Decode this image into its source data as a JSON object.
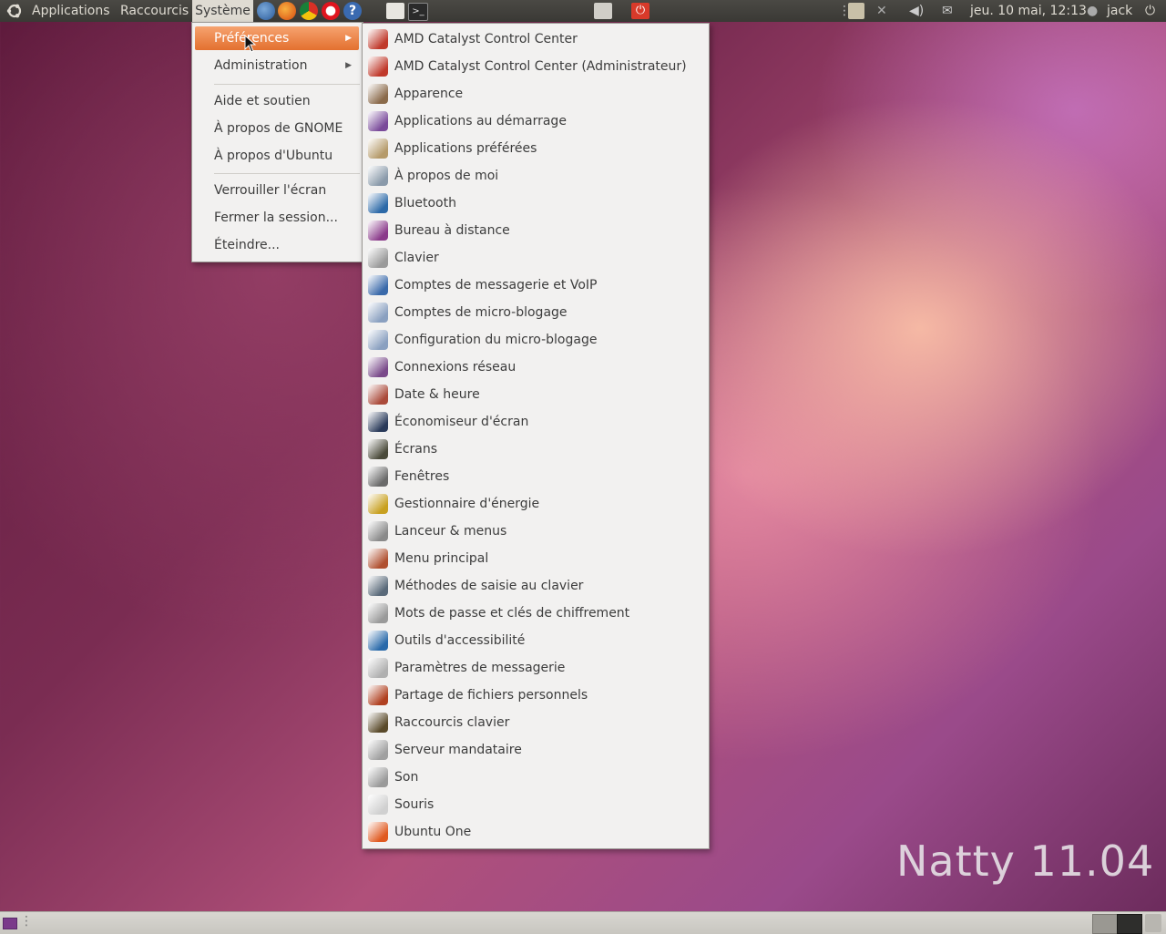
{
  "top_panel": {
    "applications": "Applications",
    "raccourcis": "Raccourcis",
    "systeme": "Système",
    "datetime": "jeu. 10 mai, 12:13",
    "user": "jack"
  },
  "system_menu": {
    "items": [
      {
        "label": "Préférences",
        "submenu": true
      },
      {
        "label": "Administration",
        "submenu": true
      },
      {
        "label": "Aide et soutien"
      },
      {
        "label": "À propos de GNOME"
      },
      {
        "label": "À propos d'Ubuntu"
      },
      {
        "label": "Verrouiller l'écran"
      },
      {
        "label": "Fermer la session..."
      },
      {
        "label": "Éteindre..."
      }
    ]
  },
  "preferences_menu": {
    "items": [
      {
        "label": "AMD Catalyst Control Center",
        "icon": "amd-catalyst-icon",
        "color": "#c0392b"
      },
      {
        "label": "AMD Catalyst Control Center (Administrateur)",
        "icon": "amd-catalyst-admin-icon",
        "color": "#c0392b"
      },
      {
        "label": "Apparence",
        "icon": "appearance-icon",
        "color": "#8a6a4a"
      },
      {
        "label": "Applications au démarrage",
        "icon": "startup-apps-icon",
        "color": "#7a4a9a"
      },
      {
        "label": "Applications préférées",
        "icon": "preferred-apps-icon",
        "color": "#b59a6a"
      },
      {
        "label": "À propos de moi",
        "icon": "about-me-icon",
        "color": "#8a9aaa"
      },
      {
        "label": "Bluetooth",
        "icon": "bluetooth-icon",
        "color": "#2d6aa8"
      },
      {
        "label": "Bureau à distance",
        "icon": "remote-desktop-icon",
        "color": "#8a3a8a"
      },
      {
        "label": "Clavier",
        "icon": "keyboard-icon",
        "color": "#9a9a9a"
      },
      {
        "label": "Comptes de messagerie et VoIP",
        "icon": "messaging-accounts-icon",
        "color": "#3a6aaa"
      },
      {
        "label": "Comptes de micro-blogage",
        "icon": "microblog-accounts-icon",
        "color": "#8aa0c0"
      },
      {
        "label": "Configuration du micro-blogage",
        "icon": "microblog-config-icon",
        "color": "#8aa0c0"
      },
      {
        "label": "Connexions réseau",
        "icon": "network-connections-icon",
        "color": "#7a4a8a"
      },
      {
        "label": "Date & heure",
        "icon": "date-time-icon",
        "color": "#aa4a3a"
      },
      {
        "label": "Économiseur d'écran",
        "icon": "screensaver-icon",
        "color": "#2a3a5a"
      },
      {
        "label": "Écrans",
        "icon": "displays-icon",
        "color": "#4a4a3a"
      },
      {
        "label": "Fenêtres",
        "icon": "windows-icon",
        "color": "#6a6a6a"
      },
      {
        "label": "Gestionnaire d'énergie",
        "icon": "power-manager-icon",
        "color": "#c8a020"
      },
      {
        "label": "Lanceur & menus",
        "icon": "launcher-menus-icon",
        "color": "#8a8a8a"
      },
      {
        "label": "Menu principal",
        "icon": "main-menu-icon",
        "color": "#b05030"
      },
      {
        "label": "Méthodes de saisie au clavier",
        "icon": "input-method-icon",
        "color": "#5a6a7a"
      },
      {
        "label": "Mots de passe et clés de chiffrement",
        "icon": "passwords-keys-icon",
        "color": "#9a9a9a"
      },
      {
        "label": "Outils d'accessibilité",
        "icon": "accessibility-icon",
        "color": "#2a6aaa"
      },
      {
        "label": "Paramètres de messagerie",
        "icon": "messaging-settings-icon",
        "color": "#b0b0b0"
      },
      {
        "label": "Partage de fichiers personnels",
        "icon": "file-sharing-icon",
        "color": "#b04020"
      },
      {
        "label": "Raccourcis clavier",
        "icon": "keyboard-shortcuts-icon",
        "color": "#5a4a2a"
      },
      {
        "label": "Serveur mandataire",
        "icon": "proxy-icon",
        "color": "#a0a0a0"
      },
      {
        "label": "Son",
        "icon": "sound-icon",
        "color": "#9a9a9a"
      },
      {
        "label": "Souris",
        "icon": "mouse-icon",
        "color": "#d0d0d0"
      },
      {
        "label": "Ubuntu One",
        "icon": "ubuntu-one-icon",
        "color": "#e05a20"
      }
    ]
  },
  "desktop": {
    "watermark": "Natty 11.04"
  },
  "colors": {
    "panel": "#3a3935",
    "menu_bg": "#f2f1f0",
    "highlight": "#e3702f"
  }
}
